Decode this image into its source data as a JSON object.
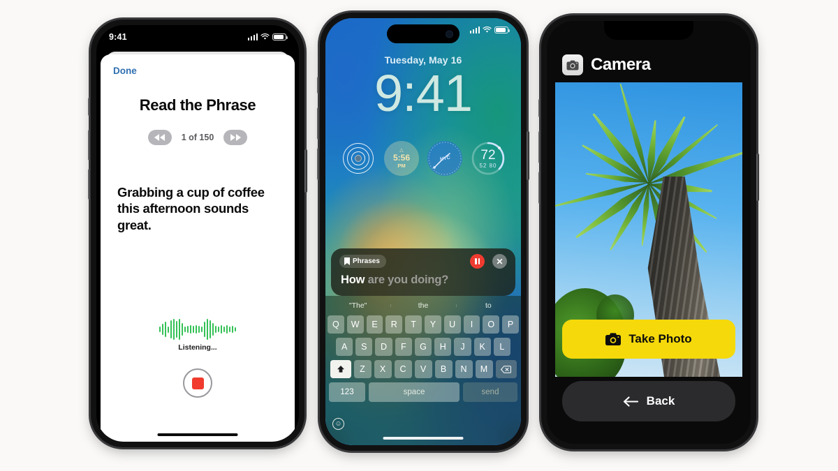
{
  "background_color": "#faf9f7",
  "phone1": {
    "name": "read-the-phrase-screen",
    "status_bar": {
      "time": "9:41",
      "signal_icon": "cellular-bars-icon",
      "wifi_icon": "wifi-icon",
      "battery_icon": "battery-icon"
    },
    "done_label": "Done",
    "title": "Read the Phrase",
    "pager": {
      "prev_icon": "rewind-icon",
      "next_icon": "fast-forward-icon",
      "label": "1 of 150"
    },
    "phrase_text": "Grabbing a cup of coffee this afternoon sounds great.",
    "waveform": {
      "icon": "audio-waveform-icon",
      "color": "#35c156"
    },
    "listening_label": "Listening...",
    "record_button": {
      "icon": "stop-record-icon",
      "color": "#f03b2e"
    }
  },
  "phone2": {
    "name": "lock-screen-with-phrases",
    "status_bar": {
      "signal_icon": "cellular-bars-icon",
      "wifi_icon": "wifi-icon",
      "battery_icon": "battery-icon"
    },
    "date": "Tuesday, May 16",
    "time": "9:41",
    "widgets": [
      {
        "name": "activity-rings-widget",
        "icon": "activity-rings-icon",
        "value": ""
      },
      {
        "name": "sunset-widget",
        "icon": "sunset-icon",
        "value": "5:56",
        "unit": "PM"
      },
      {
        "name": "stocks-widget",
        "icon": "stocks-chart-icon",
        "label": "NYC"
      },
      {
        "name": "weather-widget",
        "value": "72",
        "range": "52  80"
      }
    ],
    "phrases_card": {
      "pill_icon": "bookmark-icon",
      "pill_label": "Phrases",
      "pause_icon": "pause-icon",
      "close_icon": "close-icon",
      "typed_text": "How",
      "suggested_text": " are you doing?"
    },
    "keyboard": {
      "predictions": [
        "\"The\"",
        "the",
        "to"
      ],
      "row1": [
        "Q",
        "W",
        "E",
        "R",
        "T",
        "Y",
        "U",
        "I",
        "O",
        "P"
      ],
      "row2": [
        "A",
        "S",
        "D",
        "F",
        "G",
        "H",
        "J",
        "K",
        "L"
      ],
      "row3": [
        "Z",
        "X",
        "C",
        "V",
        "B",
        "N",
        "M"
      ],
      "shift_icon": "shift-icon",
      "backspace_icon": "backspace-icon",
      "numbers_label": "123",
      "space_label": "space",
      "send_label": "send",
      "emoji_icon": "emoji-icon"
    }
  },
  "phone3": {
    "name": "camera-action-screen",
    "app_icon": "camera-app-icon",
    "app_title": "Camera",
    "photo_alt": "palm-tree-photo",
    "take_photo": {
      "icon": "camera-icon",
      "label": "Take Photo",
      "color": "#f5d90a"
    },
    "back": {
      "icon": "arrow-left-icon",
      "label": "Back"
    }
  }
}
